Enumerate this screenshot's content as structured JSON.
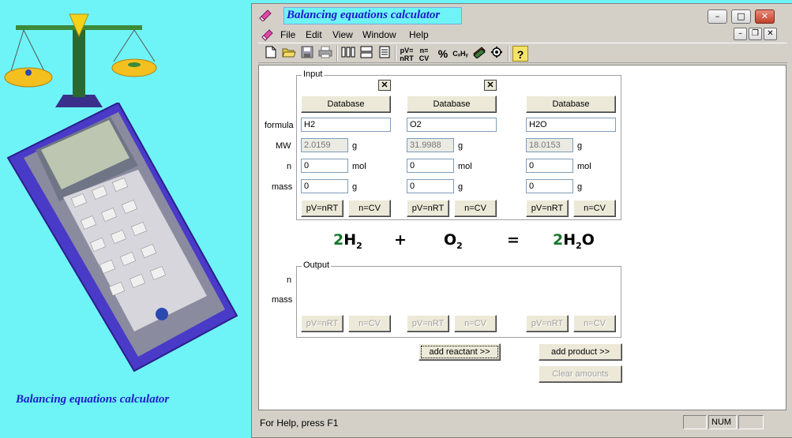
{
  "app": {
    "title": "Balancing equations calculator",
    "side_caption": "Balancing equations calculator",
    "accent_color": "#1a1acb",
    "background_color": "#6ef4f6"
  },
  "window_controls": {
    "minimize": "–",
    "maximize": "□",
    "close": "✕"
  },
  "mdi_controls": {
    "minimize": "–",
    "restore": "❐",
    "close": "✕"
  },
  "menu": [
    "File",
    "Edit",
    "View",
    "Window",
    "Help"
  ],
  "toolbar": {
    "icons": [
      "new-file-icon",
      "open-folder-icon",
      "save-icon",
      "print-icon",
      "columns-icon",
      "rows-icon",
      "document-icon",
      "pv-nrt-icon",
      "n-cv-icon",
      "percent-icon",
      "formula-icon",
      "books-icon",
      "gear-icon",
      "help-icon"
    ],
    "pv_label": "pV= nRT",
    "ncv_label": "n= CV",
    "percent_label": "%",
    "formula_label": "CₓHᵧ",
    "help_label": "?"
  },
  "input": {
    "title": "Input",
    "labels": {
      "formula": "formula",
      "mw": "MW",
      "n": "n",
      "mass": "mass"
    },
    "database_label": "Database",
    "pvnrt_label": "pV=nRT",
    "ncv_label": "n=CV",
    "close_label": "✕",
    "compounds": [
      {
        "formula": "H2",
        "mw": "2.0159",
        "mw_unit": "g",
        "n": "0",
        "n_unit": "mol",
        "mass": "0",
        "mass_unit": "g"
      },
      {
        "formula": "O2",
        "mw": "31.9988",
        "mw_unit": "g",
        "n": "0",
        "n_unit": "mol",
        "mass": "0",
        "mass_unit": "g"
      },
      {
        "formula": "H2O",
        "mw": "18.0153",
        "mw_unit": "g",
        "n": "0",
        "n_unit": "mol",
        "mass": "0",
        "mass_unit": "g"
      }
    ]
  },
  "equation": {
    "term1_coef": "2",
    "term1_el": "H",
    "term1_sub": "2",
    "plus": "+",
    "term2_el": "O",
    "term2_sub": "2",
    "equals": "=",
    "term3_coef": "2",
    "term3_el1": "H",
    "term3_sub1": "2",
    "term3_el2": "O",
    "coef_color": "#17762b"
  },
  "output": {
    "title": "Output",
    "labels": {
      "n": "n",
      "mass": "mass"
    },
    "pvnrt_label": "pV=nRT",
    "ncv_label": "n=CV"
  },
  "actions": {
    "add_reactant": "add reactant >>",
    "add_product": "add product >>",
    "clear_amounts": "Clear amounts"
  },
  "status": {
    "text": "For Help, press F1",
    "num": "NUM"
  }
}
